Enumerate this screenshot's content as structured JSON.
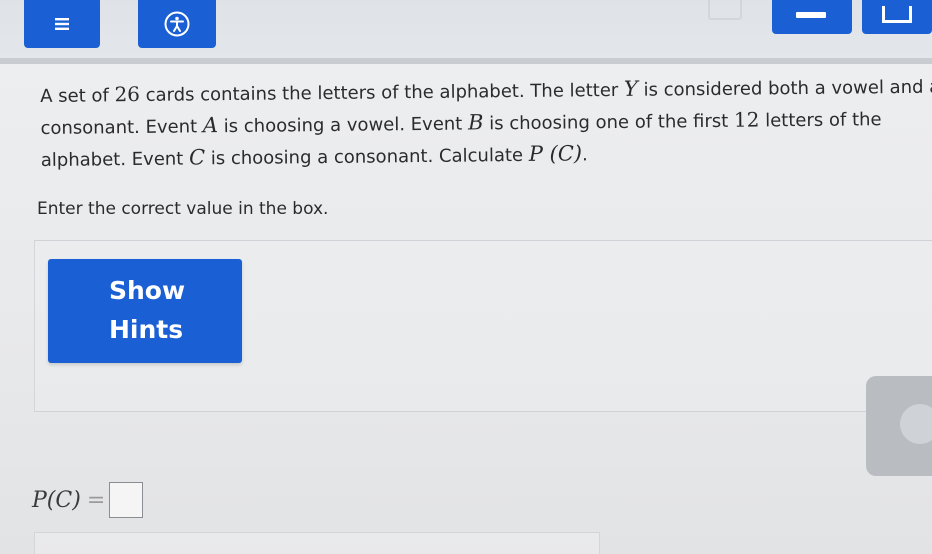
{
  "toolbar": {
    "menu_icon": "hamburger-icon",
    "accessibility_icon": "accessibility-icon",
    "accent_color": "#1a5fd4"
  },
  "question": {
    "line1": {
      "t1": "A set of ",
      "n1": "26",
      "t2": " cards contains the letters of the alphabet. The letter ",
      "m1": "Y",
      "t3": " is considered both a vowel and a"
    },
    "line2": {
      "t1": "consonant. Event ",
      "m1": "A",
      "t2": " is choosing a vowel. Event ",
      "m2": "B",
      "t3": " is choosing one of the first ",
      "n1": "12",
      "t4": " letters of the"
    },
    "line3": {
      "t1": "alphabet. Event ",
      "m1": "C",
      "t2": " is choosing a consonant. Calculate ",
      "m2": "P (C)",
      "t3": "."
    },
    "instruction": "Enter the correct value in the box."
  },
  "hints": {
    "button_line1": "Show",
    "button_line2": "Hints"
  },
  "answer": {
    "label": "P(C)",
    "equals": "=",
    "value": ""
  }
}
